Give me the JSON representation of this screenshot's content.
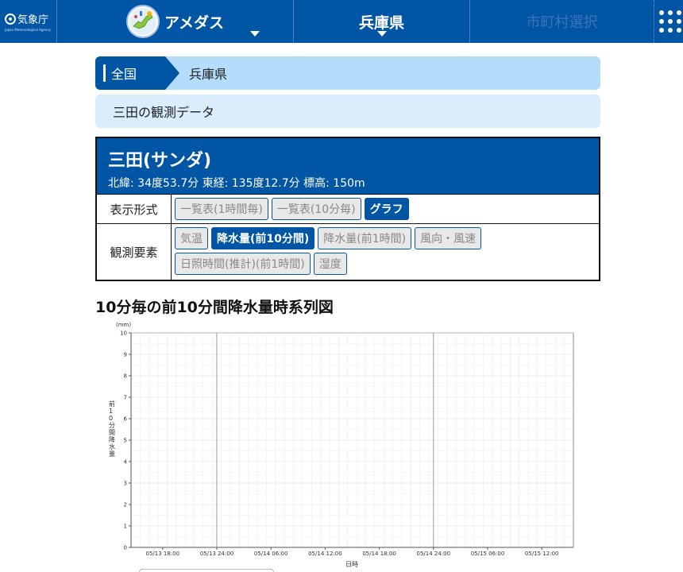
{
  "header": {
    "logo_text": "気象庁",
    "logo_sub": "Japan Meteorological Agency",
    "amedas_label": "アメダス",
    "prefecture_label": "兵庫県",
    "city_label": "市町村選択"
  },
  "breadcrumb": {
    "all": "全国",
    "prefecture": "兵庫県"
  },
  "subtitle": "三田の観測データ",
  "station": {
    "name": "三田(サンダ)",
    "coords": "北緯: 34度53.7分 東経: 135度12.7分 標高: 150m"
  },
  "display_format": {
    "label": "表示形式",
    "options": [
      "一覧表(1時間毎)",
      "一覧表(10分毎)",
      "グラフ"
    ],
    "selected": "グラフ"
  },
  "elements": {
    "label": "観測要素",
    "options": [
      "気温",
      "降水量(前10分間)",
      "降水量(前1時間)",
      "風向・風速",
      "日照時間(推計)(前1時間)",
      "湿度"
    ],
    "selected": "降水量(前10分間)"
  },
  "chart_title": "10分毎の前10分間降水量時系列図",
  "chart_data": {
    "type": "bar",
    "title": "10分毎の前10分間降水量時系列図",
    "xlabel": "日時",
    "ylabel": "前10分間降水量",
    "yunit": "(mm)",
    "ylim": [
      0,
      10
    ],
    "yticks": [
      0,
      1,
      2,
      3,
      4,
      5,
      6,
      7,
      8,
      9,
      10
    ],
    "xticks": [
      "05/13 18:00",
      "05/13 24:00",
      "05/14 06:00",
      "05/14 12:00",
      "05/14 18:00",
      "05/14 24:00",
      "05/15 06:00",
      "05/15 12:00"
    ],
    "day_boundaries": [
      "05/13 24:00",
      "05/14 24:00"
    ],
    "series": [
      {
        "name": "前10分間降水量",
        "values": []
      }
    ],
    "grid": true
  }
}
